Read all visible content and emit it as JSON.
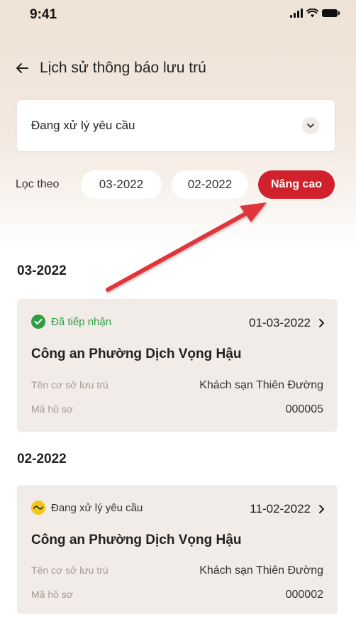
{
  "status_bar": {
    "time": "9:41"
  },
  "header": {
    "title": "Lịch sử thông báo lưu trú"
  },
  "status_filter": {
    "selected": "Đang xử lý yêu cầu"
  },
  "filter": {
    "label": "Lọc theo",
    "chips": [
      "03-2022",
      "02-2022"
    ],
    "advanced_label": "Nâng cao"
  },
  "sections": [
    {
      "title": "03-2022",
      "card": {
        "status": "Đã tiếp nhận",
        "status_color": "#2e9d43",
        "status_icon": "check-circle-icon",
        "date": "01-03-2022",
        "agency": "Công an Phường Dịch Vọng Hậu",
        "facility_label": "Tên cơ sở lưu trú",
        "facility_value": "Khách sạn Thiên Đường",
        "code_label": "Mã hồ sơ",
        "code_value": "000005"
      }
    },
    {
      "title": "02-2022",
      "card": {
        "status": "Đang xử lý yêu cầu",
        "status_color": "#f5c518",
        "status_icon": "processing-icon",
        "date": "11-02-2022",
        "agency": "Công an Phường Dịch Vọng Hậu",
        "facility_label": "Tên cơ sở lưu trú",
        "facility_value": "Khách sạn Thiên Đường",
        "code_label": "Mã hồ sơ",
        "code_value": "000002"
      }
    }
  ],
  "colors": {
    "accent": "#d1212c",
    "annotation_arrow": "#e0353b"
  }
}
